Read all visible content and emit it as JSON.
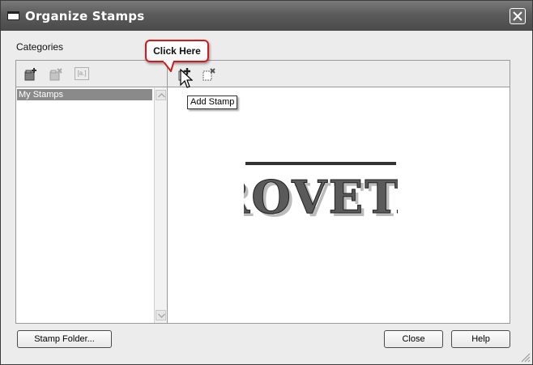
{
  "window": {
    "title": "Organize Stamps"
  },
  "categories_label": "Categories",
  "left_toolbar": {
    "icons": [
      "new-category-icon",
      "delete-category-icon",
      "rename-category-icon"
    ],
    "rename_glyph": "[a.]"
  },
  "category_list": {
    "items": [
      "My Stamps"
    ],
    "selected": "My Stamps"
  },
  "right_toolbar": {
    "icons": [
      "add-stamp-icon",
      "delete-stamp-icon"
    ]
  },
  "tooltip": "Add Stamp",
  "callout": "Click Here",
  "stamp_preview": {
    "text": "ROVETA"
  },
  "buttons": {
    "stamp_folder": "Stamp Folder...",
    "close": "Close",
    "help": "Help"
  },
  "colors": {
    "titlebar": "#5b5b5b",
    "selection": "#8a8a8a",
    "callout_border": "#d21a1a"
  }
}
